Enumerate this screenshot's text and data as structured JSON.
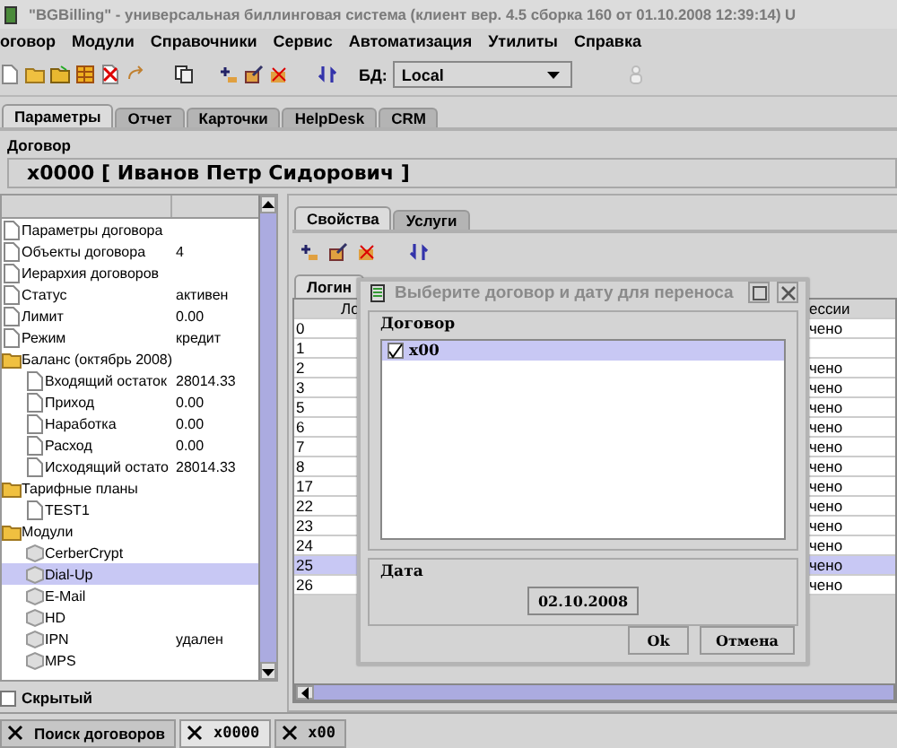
{
  "window": {
    "title": "\"BGBilling\" - универсальная биллинговая система (клиент вер. 4.5 сборка 160 от 01.10.2008 12:39:14) U"
  },
  "menu": [
    "оговор",
    "Модули",
    "Справочники",
    "Сервис",
    "Автоматизация",
    "Утилиты",
    "Справка"
  ],
  "toolbar": {
    "db_label": "БД:",
    "db_value": "Local"
  },
  "tabs": [
    {
      "label": "Параметры",
      "selected": true
    },
    {
      "label": "Отчет",
      "selected": false
    },
    {
      "label": "Карточки",
      "selected": false
    },
    {
      "label": "HelpDesk",
      "selected": false
    },
    {
      "label": "CRM",
      "selected": false
    }
  ],
  "contract_group": {
    "label": "Договор",
    "value": "x0000 [ Иванов Петр Сидорович ]"
  },
  "tree": {
    "items": [
      {
        "kind": "doc",
        "label": "Параметры договора",
        "selected": false
      },
      {
        "kind": "doc",
        "label": "Объекты договора",
        "value": "4",
        "selected": false
      },
      {
        "kind": "doc",
        "label": "Иерархия договоров",
        "selected": false
      },
      {
        "kind": "doc",
        "label": "Статус",
        "value": "активен",
        "selected": false
      },
      {
        "kind": "doc",
        "label": "Лимит",
        "value": "0.00",
        "selected": false
      },
      {
        "kind": "doc",
        "label": "Режим",
        "value": "кредит",
        "selected": false
      },
      {
        "kind": "folder",
        "label": "Баланс (октябрь 2008)",
        "selected": false,
        "children": [
          {
            "kind": "doc",
            "label": "Входящий остаток",
            "value": "28014.33",
            "selected": false
          },
          {
            "kind": "doc",
            "label": "Приход",
            "value": "0.00",
            "selected": false
          },
          {
            "kind": "doc",
            "label": "Наработка",
            "value": "0.00",
            "selected": false
          },
          {
            "kind": "doc",
            "label": "Расход",
            "value": "0.00",
            "selected": false
          },
          {
            "kind": "doc",
            "label": "Исходящий остато",
            "value": "28014.33",
            "selected": false
          }
        ]
      },
      {
        "kind": "folder",
        "label": "Тарифные планы",
        "selected": false,
        "children": [
          {
            "kind": "doc",
            "label": "TEST1",
            "selected": false
          }
        ]
      },
      {
        "kind": "folder",
        "label": "Модули",
        "selected": false,
        "children": [
          {
            "kind": "module",
            "label": "CerberCrypt",
            "selected": false
          },
          {
            "kind": "module",
            "label": "Dial-Up",
            "selected": true
          },
          {
            "kind": "module",
            "label": "E-Mail",
            "selected": false
          },
          {
            "kind": "module",
            "label": "HD",
            "selected": false
          },
          {
            "kind": "module",
            "label": "IPN",
            "value": "удален",
            "selected": false
          },
          {
            "kind": "module",
            "label": "MPS",
            "selected": false
          }
        ]
      }
    ]
  },
  "hidden_checkbox": {
    "label": "Скрытый",
    "checked": false
  },
  "right_tabs": [
    {
      "label": "Свойства",
      "selected": true
    },
    {
      "label": "Услуги",
      "selected": false
    }
  ],
  "inner_tabs": [
    {
      "label": "Логин",
      "selected": true
    }
  ],
  "table": {
    "columns": [
      "Ло",
      "ессии"
    ],
    "rows": [
      {
        "cells": [
          "0",
          "чено"
        ],
        "selected": false
      },
      {
        "cells": [
          "1",
          ""
        ],
        "selected": false
      },
      {
        "cells": [
          "2",
          "чено"
        ],
        "selected": false
      },
      {
        "cells": [
          "3",
          "чено"
        ],
        "selected": false
      },
      {
        "cells": [
          "5",
          "чено"
        ],
        "selected": false
      },
      {
        "cells": [
          "6",
          "чено"
        ],
        "selected": false
      },
      {
        "cells": [
          "7",
          "чено"
        ],
        "selected": false
      },
      {
        "cells": [
          "8",
          "чено"
        ],
        "selected": false
      },
      {
        "cells": [
          "17",
          "чено"
        ],
        "selected": false
      },
      {
        "cells": [
          "22",
          "чено"
        ],
        "selected": false
      },
      {
        "cells": [
          "23",
          "чено"
        ],
        "selected": false
      },
      {
        "cells": [
          "24",
          "чено"
        ],
        "selected": false
      },
      {
        "cells": [
          "25",
          "чено"
        ],
        "selected": true
      },
      {
        "cells": [
          "26",
          "чено"
        ],
        "selected": false
      }
    ]
  },
  "dialog": {
    "title": "Выберите договор и дату для переноса",
    "contract_label": "Договор",
    "items": [
      {
        "label": "x00",
        "checked": true,
        "selected": true
      }
    ],
    "date_label": "Дата",
    "date": "02.10.2008",
    "buttons": [
      "Ok",
      "Отмена"
    ]
  },
  "bottom_tabs": [
    {
      "label": "Поиск договоров",
      "selected": false
    },
    {
      "label": "x0000",
      "selected": true
    },
    {
      "label": "x00",
      "selected": false
    }
  ]
}
